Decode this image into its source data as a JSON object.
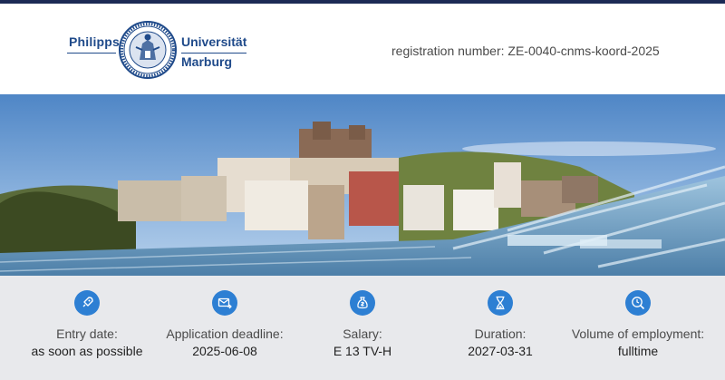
{
  "header": {
    "logo": {
      "word_left": "Philipps",
      "word_right_line1": "Universität",
      "word_right_line2": "Marburg"
    },
    "registration": "registration number: ZE-0040-cnms-koord-2025"
  },
  "colors": {
    "top_bar": "#1c2a55",
    "brand_blue": "#1f4a8a",
    "icon_blue": "#2d7fd3",
    "info_background": "#e8e9ec"
  },
  "info": [
    {
      "icon": "rocket-icon",
      "label": "Entry date:",
      "value": "as soon as possible"
    },
    {
      "icon": "mail-deadline-icon",
      "label": "Application deadline:",
      "value": "2025-06-08"
    },
    {
      "icon": "money-bag-icon",
      "label": "Salary:",
      "value": "E 13 TV-H"
    },
    {
      "icon": "hourglass-icon",
      "label": "Duration:",
      "value": "2027-03-31"
    },
    {
      "icon": "clock-search-icon",
      "label": "Volume of employment:",
      "value": "fulltime"
    }
  ]
}
